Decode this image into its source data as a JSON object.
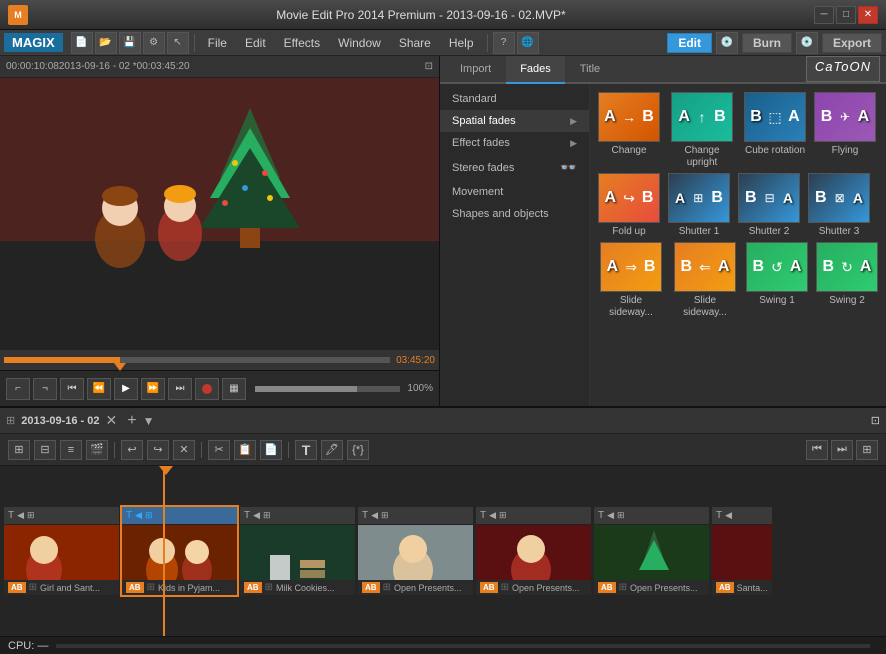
{
  "window": {
    "title": "Movie Edit Pro 2014 Premium - 2013-09-16 - 02.MVP*",
    "min_btn": "─",
    "max_btn": "□",
    "close_btn": "✕"
  },
  "menubar": {
    "logo": "MAGIX",
    "menus": [
      "File",
      "Edit",
      "Effects",
      "Window",
      "Share",
      "Help"
    ],
    "toolbar_icons": [
      "⚙",
      "🔧",
      "💾",
      "⚙",
      "↩"
    ],
    "edit_btn": "Edit",
    "burn_btn": "Burn",
    "export_btn": "Export",
    "help_icon": "?"
  },
  "preview": {
    "time_start": "00:00:10:08",
    "title": "2013-09-16 - 02 *",
    "time_end": "00:03:45:20",
    "scrubber_time": "03:45:20",
    "volume_pct": "100%"
  },
  "effects": {
    "tabs": [
      "Import",
      "Fades",
      "Title"
    ],
    "active_tab": "Fades",
    "catoon": "CaToON",
    "list_items": [
      {
        "label": "Standard",
        "has_arrow": false
      },
      {
        "label": "Spatial fades",
        "has_arrow": true
      },
      {
        "label": "Effect fades",
        "has_arrow": true
      },
      {
        "label": "Stereo fades",
        "has_arrow": false
      },
      {
        "label": "Movement",
        "has_arrow": false
      },
      {
        "label": "Shapes and objects",
        "has_arrow": false
      }
    ],
    "grid": [
      [
        {
          "label": "Change",
          "style": "fade-orange"
        },
        {
          "label": "Change upright",
          "style": "fade-teal"
        },
        {
          "label": "Cube rotation",
          "style": "fade-cube"
        },
        {
          "label": "Flying",
          "style": "fade-fly"
        }
      ],
      [
        {
          "label": "Fold up",
          "style": "fade-fold"
        },
        {
          "label": "Shutter 1",
          "style": "fade-shutter"
        },
        {
          "label": "Shutter 2",
          "style": "fade-shutter"
        },
        {
          "label": "Shutter 3",
          "style": "fade-shutter"
        }
      ],
      [
        {
          "label": "Slide sideway...",
          "style": "fade-slide"
        },
        {
          "label": "Slide sideway...",
          "style": "fade-slide"
        },
        {
          "label": "Swing 1",
          "style": "fade-swing"
        },
        {
          "label": "Swing 2",
          "style": "fade-swing"
        }
      ]
    ]
  },
  "timeline": {
    "title": "2013-09-16 - 02",
    "clips": [
      {
        "name": "Girl and Sant...",
        "thumb_class": "thumb-1"
      },
      {
        "name": "Kids in Pyjam...",
        "thumb_class": "thumb-2"
      },
      {
        "name": "Milk Cookies...",
        "thumb_class": "thumb-3"
      },
      {
        "name": "Open Presents...",
        "thumb_class": "thumb-4"
      },
      {
        "name": "Open Presents...",
        "thumb_class": "thumb-5"
      },
      {
        "name": "Open Presents...",
        "thumb_class": "thumb-6"
      },
      {
        "name": "Santa...",
        "thumb_class": "thumb-7"
      }
    ]
  },
  "statusbar": {
    "label": "CPU: —"
  }
}
